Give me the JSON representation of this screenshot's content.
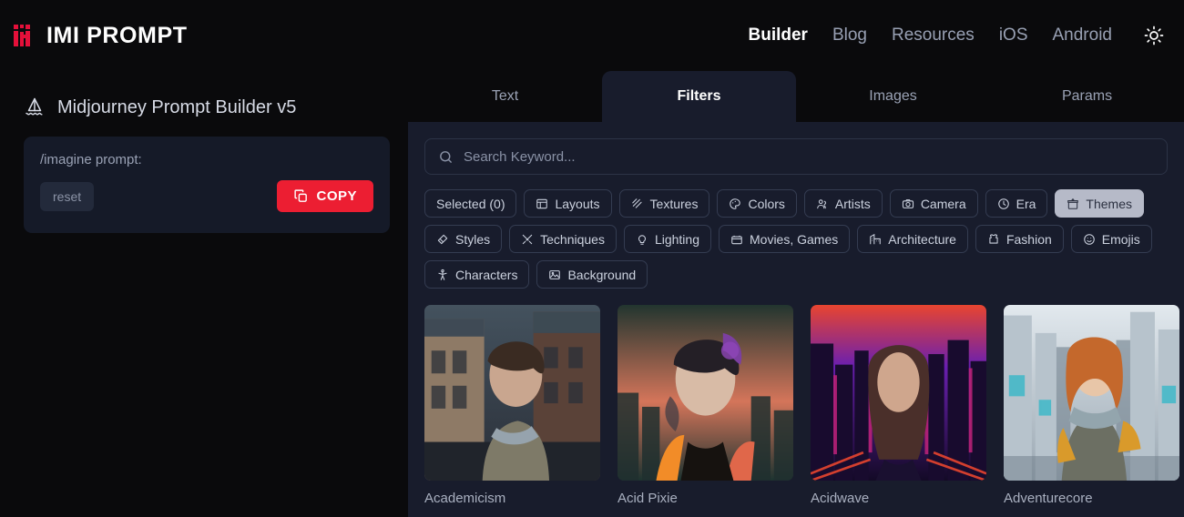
{
  "header": {
    "brand": "IMI PROMPT",
    "brand_icon": "imi-logo-icon",
    "brand_color": "#e5103a",
    "nav": [
      {
        "label": "Builder",
        "active": true
      },
      {
        "label": "Blog",
        "active": false
      },
      {
        "label": "Resources",
        "active": false
      },
      {
        "label": "iOS",
        "active": false
      },
      {
        "label": "Android",
        "active": false
      }
    ],
    "theme_toggle_icon": "sun-icon"
  },
  "left": {
    "builder_icon": "sailboat-icon",
    "builder_title": "Midjourney Prompt Builder v5",
    "prompt_label": "/imagine prompt:",
    "prompt_value": "",
    "reset_label": "reset",
    "copy_label": "COPY",
    "copy_icon": "copy-icon",
    "copy_color": "#ec1e32"
  },
  "tabs": [
    {
      "label": "Text",
      "active": false
    },
    {
      "label": "Filters",
      "active": true
    },
    {
      "label": "Images",
      "active": false
    },
    {
      "label": "Params",
      "active": false
    }
  ],
  "search": {
    "placeholder": "Search Keyword...",
    "value": "",
    "icon": "search-icon"
  },
  "chips": [
    {
      "label": "Selected (0)",
      "icon": "none",
      "active": false
    },
    {
      "label": "Layouts",
      "icon": "layout-icon",
      "active": false
    },
    {
      "label": "Textures",
      "icon": "texture-icon",
      "active": false
    },
    {
      "label": "Colors",
      "icon": "palette-icon",
      "active": false
    },
    {
      "label": "Artists",
      "icon": "users-icon",
      "active": false
    },
    {
      "label": "Camera",
      "icon": "camera-icon",
      "active": false
    },
    {
      "label": "Era",
      "icon": "clock-icon",
      "active": false
    },
    {
      "label": "Themes",
      "icon": "basket-icon",
      "active": true
    },
    {
      "label": "Styles",
      "icon": "styles-icon",
      "active": false
    },
    {
      "label": "Techniques",
      "icon": "tools-icon",
      "active": false
    },
    {
      "label": "Lighting",
      "icon": "bulb-icon",
      "active": false
    },
    {
      "label": "Movies, Games",
      "icon": "clapper-icon",
      "active": false
    },
    {
      "label": "Architecture",
      "icon": "building-icon",
      "active": false
    },
    {
      "label": "Fashion",
      "icon": "shirt-icon",
      "active": false
    },
    {
      "label": "Emojis",
      "icon": "smiley-icon",
      "active": false
    },
    {
      "label": "Characters",
      "icon": "person-icon",
      "active": false
    },
    {
      "label": "Background",
      "icon": "image-icon",
      "active": false
    }
  ],
  "cards": [
    {
      "label": "Academicism",
      "palette": [
        "#2e3742",
        "#6d5848",
        "#a9b4bd",
        "#4b5560",
        "#8e7a66"
      ]
    },
    {
      "label": "Acid Pixie",
      "palette": [
        "#1f3330",
        "#e0674a",
        "#7b3fa0",
        "#f28c28",
        "#2b4a42"
      ]
    },
    {
      "label": "Acidwave",
      "palette": [
        "#1a0b2e",
        "#c0227a",
        "#6a1fb0",
        "#e8452f",
        "#2c1060"
      ]
    },
    {
      "label": "Adventurecore",
      "palette": [
        "#cfd8df",
        "#d99a2b",
        "#6f7f8c",
        "#8e9aa6",
        "#e0c79a"
      ]
    }
  ]
}
